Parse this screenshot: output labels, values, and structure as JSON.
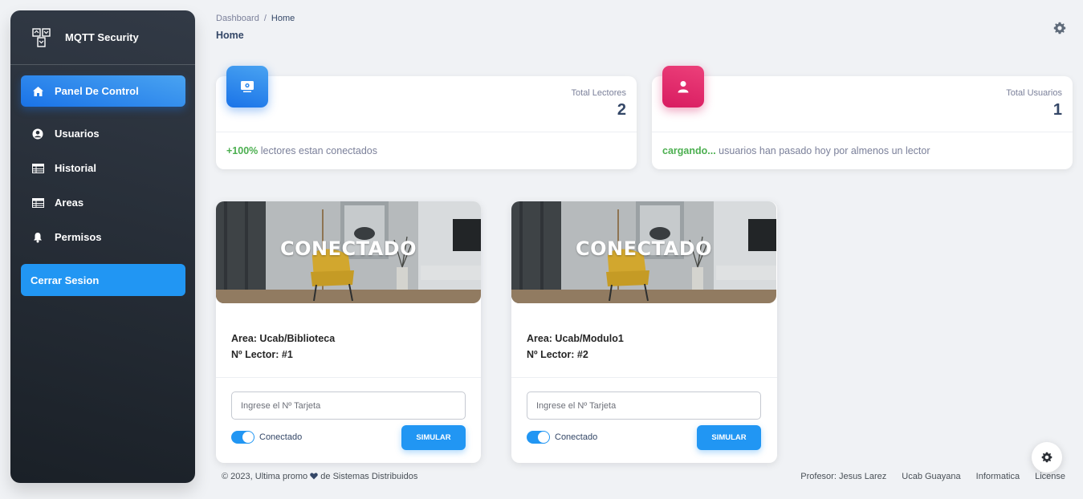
{
  "app": {
    "title": "MQTT Security"
  },
  "sidebar": {
    "items": [
      {
        "label": "Panel De Control",
        "icon": "home-icon"
      },
      {
        "label": "Usuarios",
        "icon": "user-circle-icon"
      },
      {
        "label": "Historial",
        "icon": "table-icon"
      },
      {
        "label": "Areas",
        "icon": "table-icon"
      },
      {
        "label": "Permisos",
        "icon": "bell-icon"
      }
    ],
    "logout_label": "Cerrar Sesion"
  },
  "header": {
    "breadcrumb_root": "Dashboard",
    "breadcrumb_sep": "/",
    "breadcrumb_current": "Home",
    "title": "Home"
  },
  "stats": {
    "readers": {
      "label": "Total Lectores",
      "value": "2",
      "highlight": "+100%",
      "text": " lectores estan conectados",
      "icon": "reader-icon"
    },
    "users": {
      "label": "Total Usuarios",
      "value": "1",
      "highlight": "cargando...",
      "text": " usuarios han pasado hoy por almenos un lector",
      "icon": "person-icon"
    }
  },
  "readers": [
    {
      "status": "CONECTADO",
      "area": "Area: Ucab/Biblioteca",
      "lector": "Nº Lector: #1",
      "placeholder": "Ingrese el Nº Tarjeta",
      "toggle_label": "Conectado",
      "button": "SIMULAR"
    },
    {
      "status": "CONECTADO",
      "area": "Area: Ucab/Modulo1",
      "lector": "Nº Lector: #2",
      "placeholder": "Ingrese el Nº Tarjeta",
      "toggle_label": "Conectado",
      "button": "SIMULAR"
    }
  ],
  "footer": {
    "left_prefix": "© 2023, Ultima promo",
    "left_suffix": "de Sistemas Distribuidos",
    "links": [
      "Profesor: Jesus Larez",
      "Ucab Guayana",
      "Informatica",
      "License"
    ]
  },
  "colors": {
    "accent": "#2196f3",
    "pink": "#d81b60",
    "success": "#4caf50",
    "sidebar": "#2a313b"
  }
}
